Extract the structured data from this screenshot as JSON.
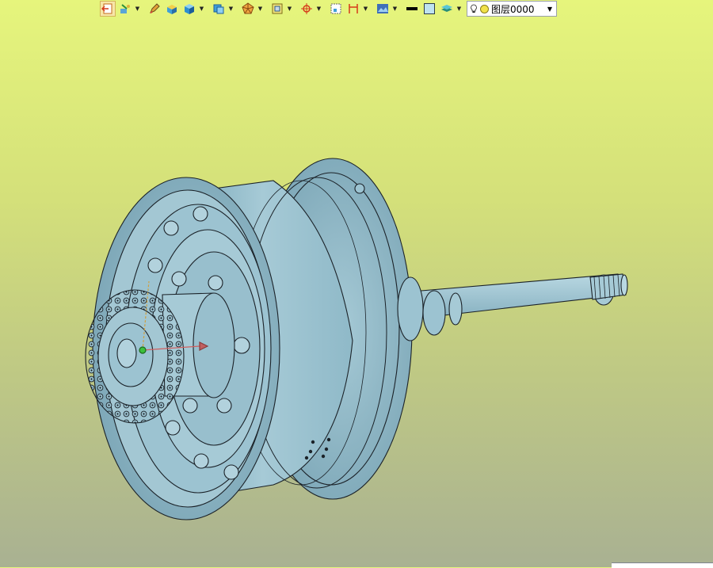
{
  "toolbar": {
    "buttons": [
      {
        "icon": "exit-sketch-icon"
      },
      {
        "icon": "inspector-icon"
      },
      {
        "icon": "pencil-icon"
      },
      {
        "icon": "display-mode-icon"
      },
      {
        "icon": "shaded-solid-icon"
      },
      {
        "icon": "view-cube-icon"
      },
      {
        "icon": "polyhedron-icon"
      },
      {
        "icon": "section-icon"
      },
      {
        "icon": "datum-point-icon"
      },
      {
        "icon": "render-region-icon"
      },
      {
        "icon": "dimension-icon"
      },
      {
        "icon": "appearance-icon"
      },
      {
        "icon": "line-color-icon"
      },
      {
        "icon": "fill-color-icon"
      },
      {
        "icon": "layer-stack-icon"
      }
    ],
    "layer": {
      "icon": "lightbulb-icon",
      "value": "图层0000"
    }
  },
  "colors": {
    "background_top": "#e6f57c",
    "background_bottom": "#a9b192",
    "model_face": "#9cc3d1",
    "model_edge": "#1b2228"
  }
}
